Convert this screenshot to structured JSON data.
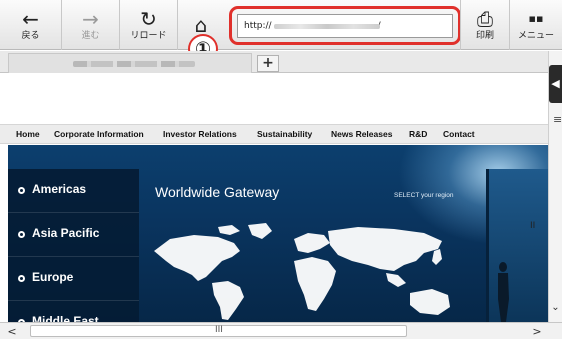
{
  "toolbar": {
    "back": {
      "icon": "←",
      "label": "戻る"
    },
    "forward": {
      "icon": "→",
      "label": "進む"
    },
    "reload": {
      "icon": "↻",
      "label": "リロード"
    },
    "home": {
      "icon": "⌂"
    },
    "print": {
      "icon": "⎙",
      "label": "印刷"
    },
    "menu": {
      "icon": "▪▪",
      "label": "メニュー"
    }
  },
  "address_bar": {
    "url_prefix": "http://",
    "url_suffix": "/"
  },
  "callout": {
    "number": "①",
    "highlight_color": "#e0302b"
  },
  "tabbar": {
    "new_tab": "+"
  },
  "side_handle": {
    "icon": "◀",
    "menu_icon": "≡"
  },
  "site_nav": [
    "Home",
    "Corporate Information",
    "Investor Relations",
    "Sustainability",
    "News Releases",
    "R&D",
    "Contact"
  ],
  "hero": {
    "title": "Worldwide Gateway",
    "select_text": "SELECT your region",
    "regions": [
      "Americas",
      "Asia Pacific",
      "Europe",
      "Middle East"
    ]
  },
  "scrollbar": {
    "left": "<",
    "thumb_mark": "III",
    "right": ">",
    "down": "⌄",
    "side_mark": "II"
  }
}
